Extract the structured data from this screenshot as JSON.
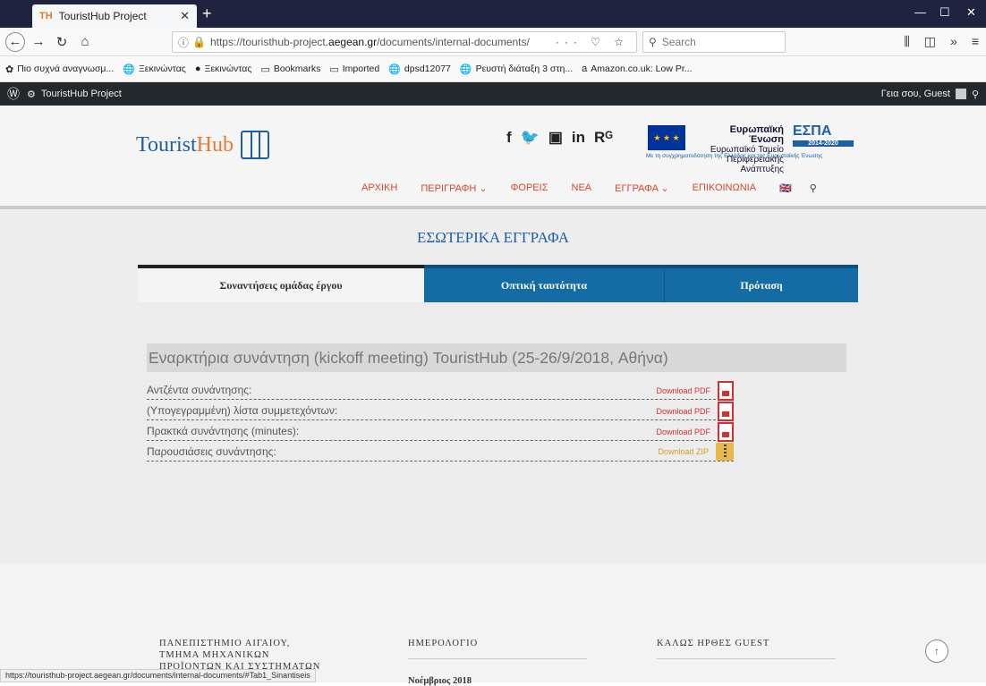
{
  "browser": {
    "tab_title": "TouristHub Project",
    "tab_favicon": "TH",
    "new_tab": "+",
    "url_prefix": "https://touristhub-project.",
    "url_host": "aegean.gr",
    "url_path": "/documents/internal-documents/",
    "url_actions": "··· ♡ ☆",
    "search_placeholder": "Search",
    "status_url": "https://touristhub-project.aegean.gr/documents/internal-documents/#Tab1_Sinantiseis"
  },
  "bookmarks": [
    {
      "label": "Πιο συχνά αναγνωσμ...",
      "icon": "gear-icon"
    },
    {
      "label": "Ξεκινώντας",
      "icon": "globe-icon"
    },
    {
      "label": "Ξεκινώντας",
      "icon": "firefox-icon"
    },
    {
      "label": "Bookmarks",
      "icon": "folder-icon"
    },
    {
      "label": "Imported",
      "icon": "folder-icon"
    },
    {
      "label": "dpsd12077",
      "icon": "globe-icon"
    },
    {
      "label": "Ρευστή διάταξη 3 στη...",
      "icon": "globe-icon"
    },
    {
      "label": "Amazon.co.uk: Low Pr...",
      "icon": "amazon-icon"
    }
  ],
  "wpbar": {
    "site_name": "TouristHub Project",
    "greeting": "Γεια σου, Guest"
  },
  "header": {
    "logo_tourist": "Tourist",
    "logo_hub": "Hub",
    "social": [
      "f",
      "🐦",
      "▣",
      "in",
      "Rᴳ"
    ],
    "eu_title": "Ευρωπαϊκή Ένωση",
    "eu_fund": "Ευρωπαϊκό Ταμείο",
    "eu_dev": "Περιφερειακής Ανάπτυξης",
    "espa": "ΕΣΠΑ",
    "espa_years": "2014-2020",
    "eu_subtitle": "Με τη συγχρηματοδότηση της Ελλάδας και της Ευρωπαϊκής Ένωσης"
  },
  "menu": [
    {
      "label": "ΑΡΧΙΚΗ"
    },
    {
      "label": "ΠΕΡΙΓΡΑΦΗ ⌄"
    },
    {
      "label": "ΦΟΡΕΙΣ"
    },
    {
      "label": "ΝΕΑ"
    },
    {
      "label": "ΕΓΓΡΑΦΑ ⌄"
    },
    {
      "label": "ΕΠΙΚΟΙΝΩΝΙΑ"
    }
  ],
  "page": {
    "title": "ΕΣΩΤΕΡΙΚΑ ΕΓΓΡΑΦΑ",
    "tabs": [
      "Συναντήσεις ομάδας έργου",
      "Οπτική ταυτότητα",
      "Πρόταση"
    ],
    "meeting_title": "Εναρκτήρια συνάντηση (kickoff meeting) TouristHub (25-26/9/2018, Αθήνα)",
    "rows": [
      {
        "label": "Αντζέντα συνάντησης:",
        "link": "Download PDF",
        "type": "pdf"
      },
      {
        "label": "(Υπογεγραμμένη) λίστα συμμετεχόντων:",
        "link": "Download PDF",
        "type": "pdf"
      },
      {
        "label": "Πρακτκά συνάντησης (minutes):",
        "link": "Download PDF",
        "type": "pdf"
      },
      {
        "label": "Παρουσιάσεις συνάντησης:",
        "link": "Download ZIP",
        "type": "zip"
      }
    ]
  },
  "footer": {
    "col1_line1": "ΠΑΝΕΠΙΣΤΗΜΙΟ ΑΙΓΑΙΟΥ,",
    "col1_line2": "ΤΜΗΜΑ ΜΗΧΑΝΙΚΩΝ",
    "col1_line3": "ΠΡΟΪΟΝΤΩΝ ΚΑΙ ΣΥΣΤΗΜΑΤΩΝ",
    "col2_title": "ΗΜΕΡΟΛΟΓΙΟ",
    "col2_month": "Νοέμβριος 2018",
    "col3_title": "ΚΑΛΩΣ ΗΡΘΕΣ GUEST"
  }
}
